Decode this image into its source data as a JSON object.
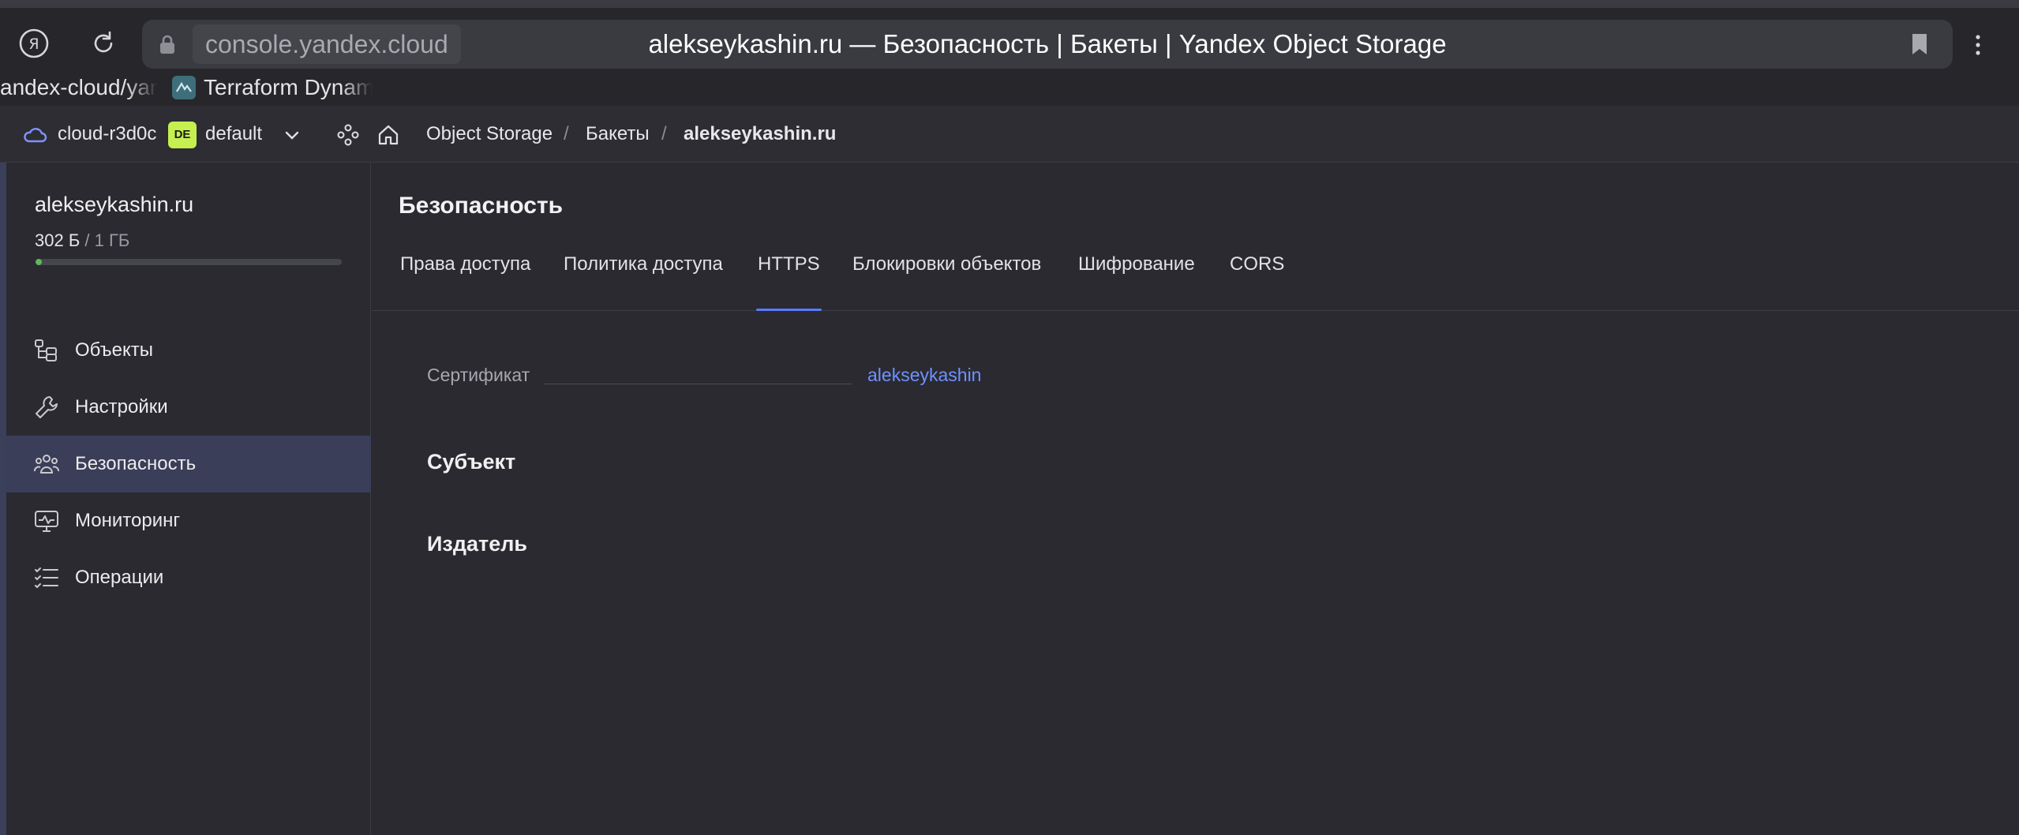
{
  "browser": {
    "domain": "console.yandex.cloud",
    "tab_title": "alekseykashin.ru — Безопасность | Бакеты | Yandex Object Storage",
    "bookmarks": [
      {
        "label": "andex-cloud/yan"
      },
      {
        "label": "Terraform Dynami"
      }
    ]
  },
  "header": {
    "cloud": "cloud-r3d0c",
    "folder_badge": "DE",
    "folder": "default",
    "breadcrumbs": [
      "Object Storage",
      "Бакеты",
      "alekseykashin.ru"
    ],
    "separator": "/"
  },
  "sidebar": {
    "bucket_name": "alekseykashin.ru",
    "usage_used": "302 Б",
    "usage_total": " / 1 ГБ",
    "usage_fraction": 0.02,
    "items": [
      {
        "label": "Объекты",
        "icon": "objects-icon",
        "active": false
      },
      {
        "label": "Настройки",
        "icon": "wrench-icon",
        "active": false
      },
      {
        "label": "Безопасность",
        "icon": "users-icon",
        "active": true
      },
      {
        "label": "Мониторинг",
        "icon": "monitor-icon",
        "active": false
      },
      {
        "label": "Операции",
        "icon": "list-icon",
        "active": false
      }
    ]
  },
  "main": {
    "title": "Безопасность",
    "tabs": [
      {
        "label": "Права доступа",
        "active": false
      },
      {
        "label": "Политика доступа",
        "active": false
      },
      {
        "label": "HTTPS",
        "active": true
      },
      {
        "label": "Блокировки объектов",
        "active": false
      },
      {
        "label": "Шифрование",
        "active": false
      },
      {
        "label": "CORS",
        "active": false
      }
    ],
    "certificate_label": "Сертификат",
    "certificate_value": "alekseykashin",
    "subject_heading": "Субъект",
    "issuer_heading": "Издатель"
  },
  "colors": {
    "accent": "#5b7cff",
    "link": "#6f91ff",
    "active_nav": "#3a3e58",
    "badge": "#c5f04f",
    "usage_fill": "#5fb85a"
  }
}
